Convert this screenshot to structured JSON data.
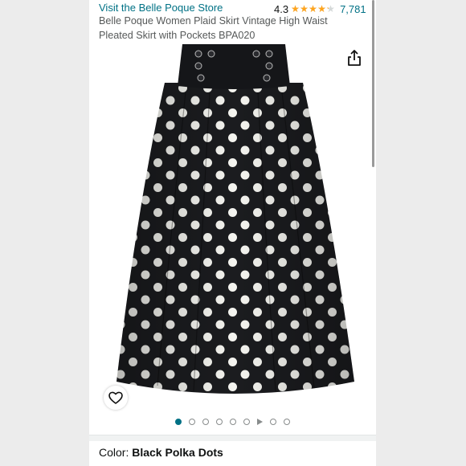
{
  "store": {
    "link_text": "Visit the Belle Poque Store"
  },
  "rating": {
    "value": "4.3",
    "stars_filled": 4.3,
    "stars_total": 5,
    "count": "7,781"
  },
  "product": {
    "title": "Belle Poque Women Plaid Skirt Vintage High Waist Pleated Skirt with Pockets BPA020"
  },
  "icons": {
    "share": "share-icon",
    "wishlist": "heart-icon",
    "video": "play-icon"
  },
  "carousel": {
    "total": 9,
    "active_index": 0,
    "video_index": 6
  },
  "variation": {
    "label": "Color: ",
    "value": "Black Polka Dots"
  },
  "colors": {
    "link": "#007185",
    "star": "#FFA41C",
    "text": "#0F1111",
    "skirt": "#1b1c1f",
    "dot": "#f5f5f0"
  }
}
